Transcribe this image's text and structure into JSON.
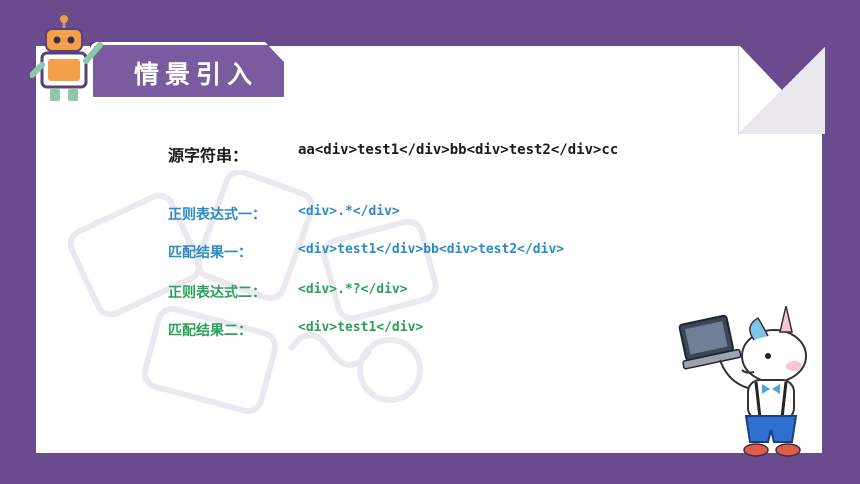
{
  "header": {
    "title": "情景引入"
  },
  "content": {
    "source": {
      "label": "源字符串：",
      "value": "aa<div>test1</div>bb<div>test2</div>cc"
    },
    "regex1": {
      "label": "正则表达式一：",
      "value": "<div>.*</div>"
    },
    "result1": {
      "label": "匹配结果一：",
      "value": "<div>test1</div>bb<div>test2</div>"
    },
    "regex2": {
      "label": "正则表达式二：",
      "value": "<div>.*?</div>"
    },
    "result2": {
      "label": "匹配结果二：",
      "value": "<div>test1</div>"
    }
  },
  "colors": {
    "background": "#6a4b8e",
    "accent_blue": "#2a8bc7",
    "accent_green": "#2aa05a"
  },
  "icons": [
    "robot-icon",
    "unicorn-laptop-mascot"
  ]
}
